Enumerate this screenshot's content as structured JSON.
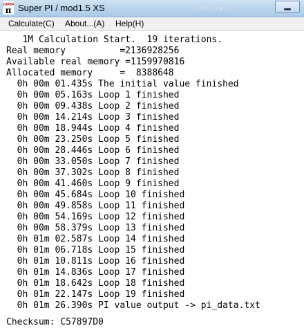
{
  "window": {
    "title": "Super PI / mod1.5 XS",
    "watermark": "Hot3c.com",
    "icon_name": "super-pi-app-icon"
  },
  "menu": [
    {
      "label": "Calculate(C)"
    },
    {
      "label": "About...(A)"
    },
    {
      "label": "Help(H)"
    }
  ],
  "output": {
    "header": "   1M Calculation Start.  19 iterations.",
    "real_memory": "Real memory          =2136928256",
    "available_memory": "Available real memory =1159970816",
    "allocated_memory": "Allocated memory     =  8388648",
    "log_lines": [
      "  0h 00m 01.435s The initial value finished",
      "  0h 00m 05.163s Loop 1 finished",
      "  0h 00m 09.438s Loop 2 finished",
      "  0h 00m 14.214s Loop 3 finished",
      "  0h 00m 18.944s Loop 4 finished",
      "  0h 00m 23.250s Loop 5 finished",
      "  0h 00m 28.446s Loop 6 finished",
      "  0h 00m 33.050s Loop 7 finished",
      "  0h 00m 37.302s Loop 8 finished",
      "  0h 00m 41.460s Loop 9 finished",
      "  0h 00m 45.684s Loop 10 finished",
      "  0h 00m 49.858s Loop 11 finished",
      "  0h 00m 54.169s Loop 12 finished",
      "  0h 00m 58.379s Loop 13 finished",
      "  0h 01m 02.587s Loop 14 finished",
      "  0h 01m 06.718s Loop 15 finished",
      "  0h 01m 10.811s Loop 16 finished",
      "  0h 01m 14.836s Loop 17 finished",
      "  0h 01m 18.642s Loop 18 finished",
      "  0h 01m 22.147s Loop 19 finished",
      "  0h 01m 26.390s PI value output -> pi_data.txt"
    ],
    "checksum": "Checksum: C57897D0"
  }
}
